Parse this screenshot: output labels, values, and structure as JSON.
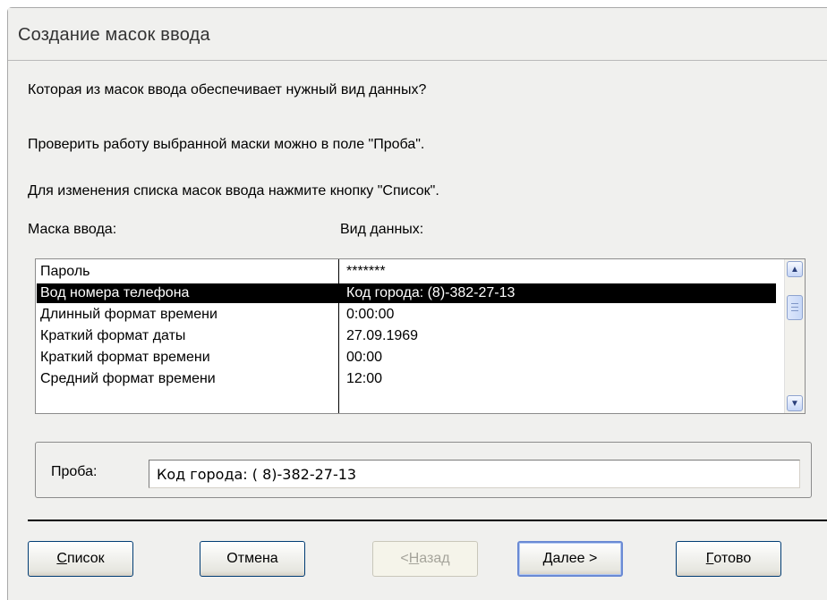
{
  "window": {
    "title": "Создание масок ввода"
  },
  "instructions": {
    "line1": "Которая из масок ввода обеспечивает нужный вид данных?",
    "line2": "Проверить работу выбранной маски можно в поле \"Проба\".",
    "line3": "Для изменения списка масок ввода нажмите кнопку \"Список\"."
  },
  "columns": {
    "mask": "Маска ввода:",
    "view": "Вид данных:"
  },
  "rows": [
    {
      "mask": "Пароль",
      "view": "*******"
    },
    {
      "mask": "Вод номера телефона",
      "view": "Код города: (8)-382-27-13",
      "selected": true
    },
    {
      "mask": "Длинный формат времени",
      "view": "0:00:00"
    },
    {
      "mask": "Краткий формат даты",
      "view": "27.09.1969"
    },
    {
      "mask": "Краткий формат времени",
      "view": "00:00"
    },
    {
      "mask": "Средний формат времени",
      "view": "12:00"
    }
  ],
  "probe": {
    "label": "Проба:",
    "value": "Код города: ( 8)-382-27-13"
  },
  "buttons": {
    "list_first": "С",
    "list_rest": "писок",
    "cancel": "Отмена",
    "back_pre": "< ",
    "back_first": "Н",
    "back_rest": "азад",
    "next_first": "Д",
    "next_rest": "алее >",
    "finish_first": "Г",
    "finish_rest": "отово"
  },
  "icons": {
    "scroll_up": "▲",
    "scroll_down": "▼"
  },
  "colors": {
    "selection": "#000000",
    "default_button_border": "#6a8ad4"
  }
}
